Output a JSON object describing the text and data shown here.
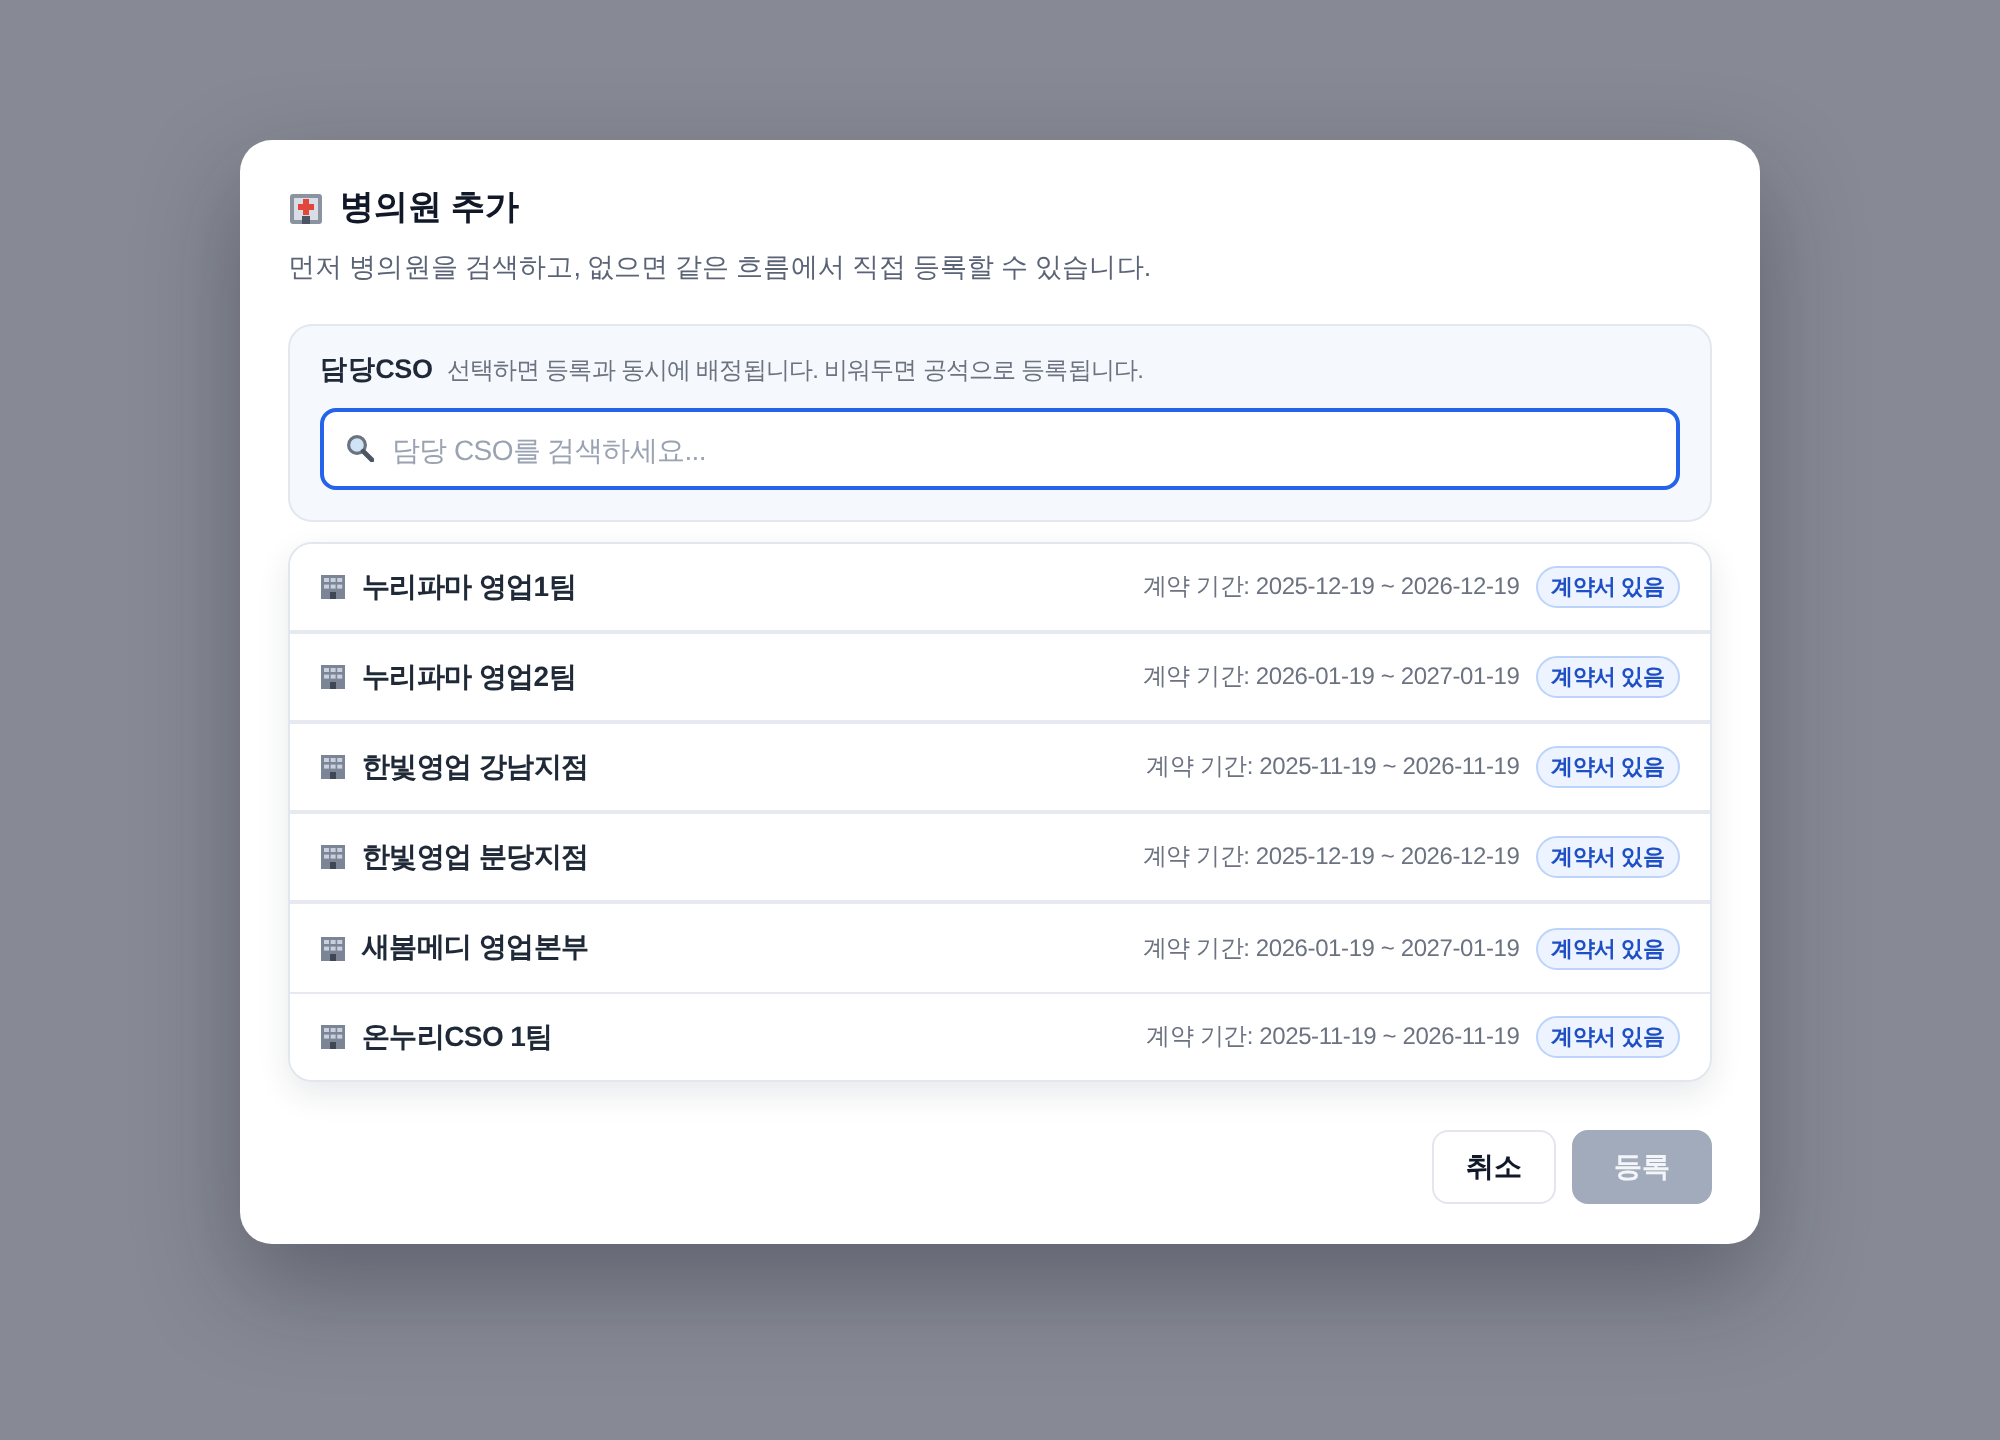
{
  "dialog": {
    "title": "병의원 추가",
    "subtitle": "먼저 병의원을 검색하고, 없으면 같은 흐름에서 직접 등록할 수 있습니다."
  },
  "cso_panel": {
    "label": "담당CSO",
    "hint": "선택하면 등록과 동시에 배정됩니다. 비워두면 공석으로 등록됩니다.",
    "search": {
      "placeholder": "담당 CSO를 검색하세요...",
      "focused": true
    }
  },
  "results": [
    {
      "name": "누리파마 영업1팀",
      "period": "계약 기간: 2025-12-19 ~ 2026-12-19",
      "badge": "계약서 있음"
    },
    {
      "name": "누리파마 영업2팀",
      "period": "계약 기간: 2026-01-19 ~ 2027-01-19",
      "badge": "계약서 있음"
    },
    {
      "name": "한빛영업 강남지점",
      "period": "계약 기간: 2025-11-19 ~ 2026-11-19",
      "badge": "계약서 있음"
    },
    {
      "name": "한빛영업 분당지점",
      "period": "계약 기간: 2025-12-19 ~ 2026-12-19",
      "badge": "계약서 있음"
    },
    {
      "name": "새봄메디 영업본부",
      "period": "계약 기간: 2026-01-19 ~ 2027-01-19",
      "badge": "계약서 있음"
    },
    {
      "name": "온누리CSO 1팀",
      "period": "계약 기간: 2025-11-19 ~ 2026-11-19",
      "badge": "계약서 있음"
    }
  ],
  "buttons": [
    {
      "label": "취소",
      "kind": "secondary",
      "disabled": false
    },
    {
      "label": "등록",
      "kind": "primary",
      "disabled": true
    }
  ]
}
